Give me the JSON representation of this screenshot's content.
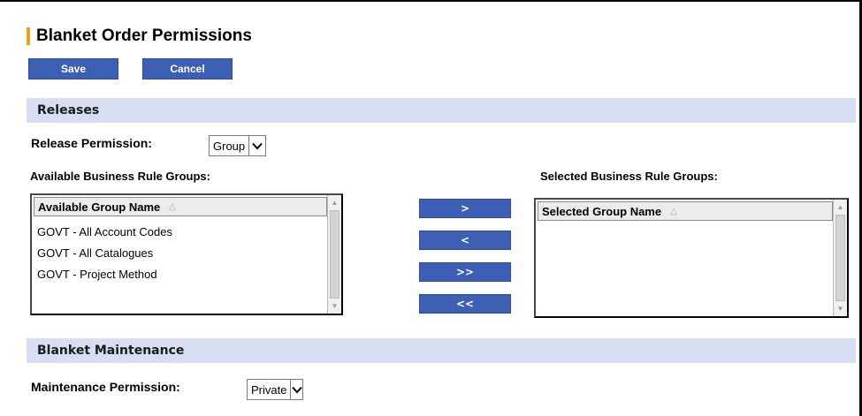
{
  "page": {
    "title": "Blanket Order Permissions",
    "accent_color": "#f59a1c"
  },
  "toolbar": {
    "save_label": "Save",
    "cancel_label": "Cancel",
    "button_color": "#3d5fb4"
  },
  "releases": {
    "section_title": "Releases",
    "permission_label": "Release Permission:",
    "permission_value": "Group",
    "available_label": "Available Business Rule Groups:",
    "selected_label": "Selected Business Rule Groups:",
    "available_list": {
      "header": "Available Group Name",
      "items": [
        "GOVT - All Account Codes",
        "GOVT - All Catalogues",
        "GOVT - Project Method"
      ]
    },
    "selected_list": {
      "header": "Selected Group Name",
      "items": []
    },
    "move_buttons": {
      "add": ">",
      "remove": "<",
      "add_all": ">>",
      "remove_all": "<<"
    }
  },
  "maintenance": {
    "section_title": "Blanket Maintenance",
    "permission_label": "Maintenance Permission:",
    "permission_value": "Private"
  },
  "icons": {
    "sort": "sort-ascending-icon",
    "dropdown": "chevron-down-icon",
    "scroll_up": "scroll-up-arrow-icon",
    "scroll_down": "scroll-down-arrow-icon"
  },
  "colors": {
    "section_bar": "#d8ddf1"
  }
}
